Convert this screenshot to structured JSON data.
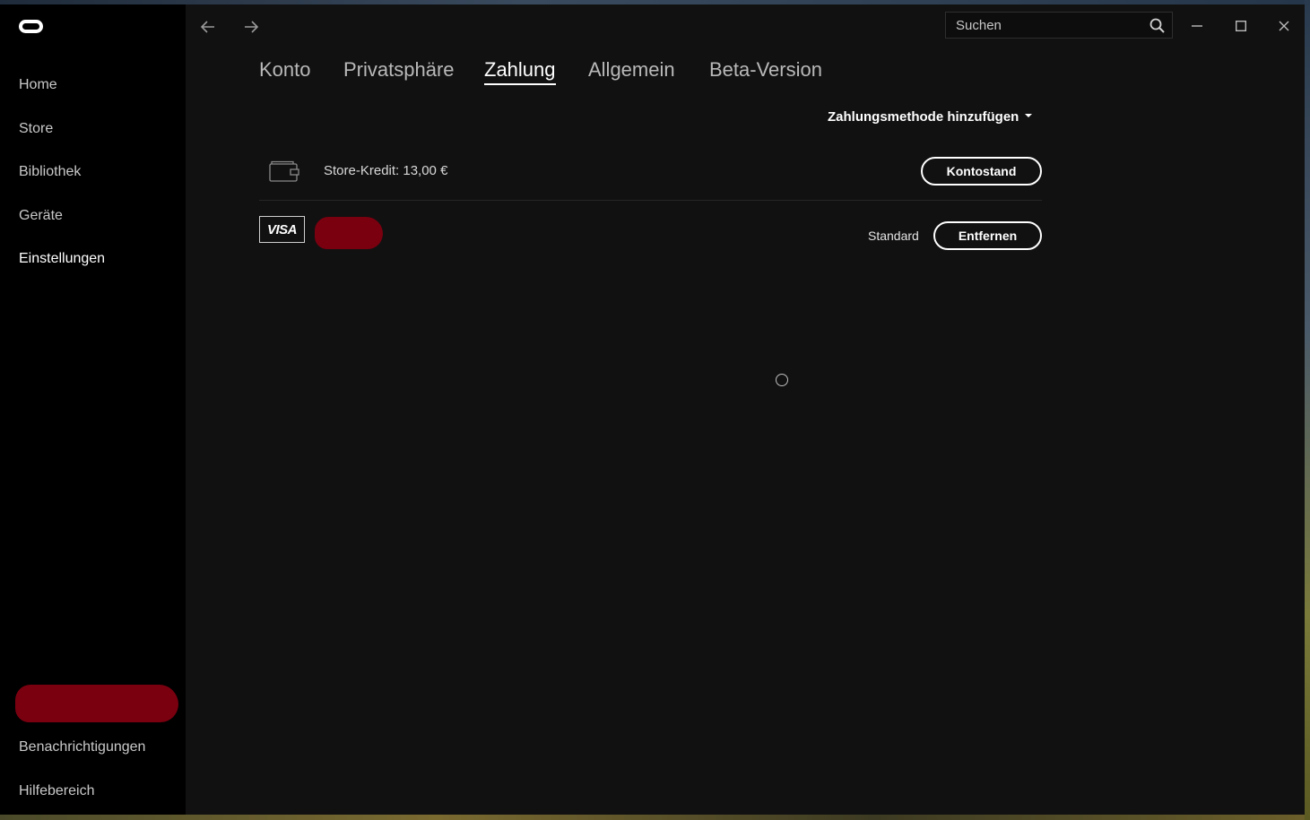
{
  "sidebar": {
    "items": [
      {
        "label": "Home"
      },
      {
        "label": "Store"
      },
      {
        "label": "Bibliothek"
      },
      {
        "label": "Geräte"
      },
      {
        "label": "Einstellungen",
        "active": true
      }
    ],
    "bottom_items": [
      {
        "label": "Benachrichtigungen"
      },
      {
        "label": "Hilfebereich"
      }
    ]
  },
  "titlebar": {
    "search_placeholder": "Suchen",
    "icons": [
      "arrow-left-icon",
      "arrow-right-icon",
      "search-icon",
      "minimize-icon",
      "maximize-icon",
      "close-icon"
    ]
  },
  "tabs": [
    {
      "label": "Konto"
    },
    {
      "label": "Privatsphäre"
    },
    {
      "label": "Zahlung",
      "active": true
    },
    {
      "label": "Allgemein"
    },
    {
      "label": "Beta-Version"
    }
  ],
  "payment": {
    "add_method_label": "Zahlungsmethode hinzufügen",
    "store_credit_label": "Store-Kredit: 13,00 €",
    "balance_button": "Kontostand",
    "card_brand": "VISA",
    "default_label": "Standard",
    "remove_button": "Entfernen"
  },
  "colors": {
    "sidebar_bg": "#000000",
    "content_bg": "#111111",
    "redaction": "#7a0010",
    "text_primary": "#ffffff",
    "text_secondary": "#c9c9c9"
  }
}
